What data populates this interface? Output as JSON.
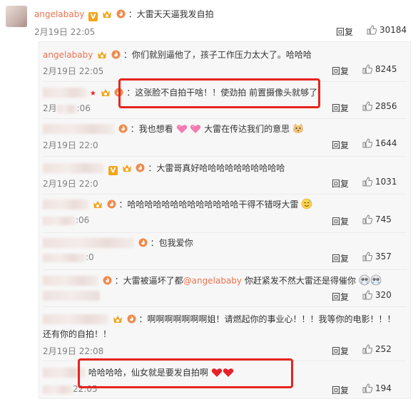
{
  "main_comment": {
    "username": "angelababy",
    "text": "：大雷天天逼我发自拍",
    "date": "2月19日 22:05",
    "reply_label": "回复",
    "likes": "30184"
  },
  "replies": [
    {
      "username": "angelababy",
      "text": "：你们就别逼他了，孩子工作压力太大了。哈哈哈",
      "date": "2月19日 22:05",
      "reply_label": "回复",
      "likes": "8245"
    },
    {
      "text": "：这张脸不自拍干啥！！使劲拍 前置摄像头就够了！",
      "date": "2月",
      "date_rest": ":06",
      "reply_label": "回复",
      "likes": "2856"
    },
    {
      "text_a": "：我也想看",
      "text_b": "大雷在传达我们的意思",
      "date": "2月19日 22:0",
      "reply_label": "回复",
      "likes": "1644"
    },
    {
      "text": "：大雷哥真好哈哈哈哈哈哈哈哈哈哈",
      "date": "2月19日 22:0",
      "reply_label": "回复",
      "likes": "1031"
    },
    {
      "text": "：哈哈哈哈哈哈哈哈哈哈哈哈哈干得不错呀大雷",
      "date_rest": ":06",
      "reply_label": "回复",
      "likes": "745"
    },
    {
      "text": "：包我爱你",
      "date_rest": ":0",
      "reply_label": "回复",
      "likes": "357"
    },
    {
      "text_a": "：大雷被逼坏了都",
      "mention": "@angelababy",
      "text_b": " 你赶紧发不然大雷还是得催你",
      "reply_label": "回复",
      "likes": "320"
    },
    {
      "text": "：啊啊啊啊啊啊啊姐！请燃起你的事业心！！！我等你的电影！！！",
      "text_cont": "还有你的自拍！！",
      "date": "2月19日 22:08",
      "reply_label": "回复",
      "likes": "252"
    },
    {
      "text": "哈哈哈哈，仙女就是要发自拍啊",
      "date_rest": "22:05",
      "reply_label": "回复",
      "likes": "194"
    }
  ],
  "colors": {
    "username": "#eb7350",
    "highlight": "#e6241f",
    "date": "#808080"
  },
  "icons": [
    "v-verified-badge",
    "vip-badge",
    "fire-badge",
    "thumb-up-icon",
    "heart-emoji",
    "cat-emoji",
    "sweat-emoji",
    "crying-emoji"
  ]
}
